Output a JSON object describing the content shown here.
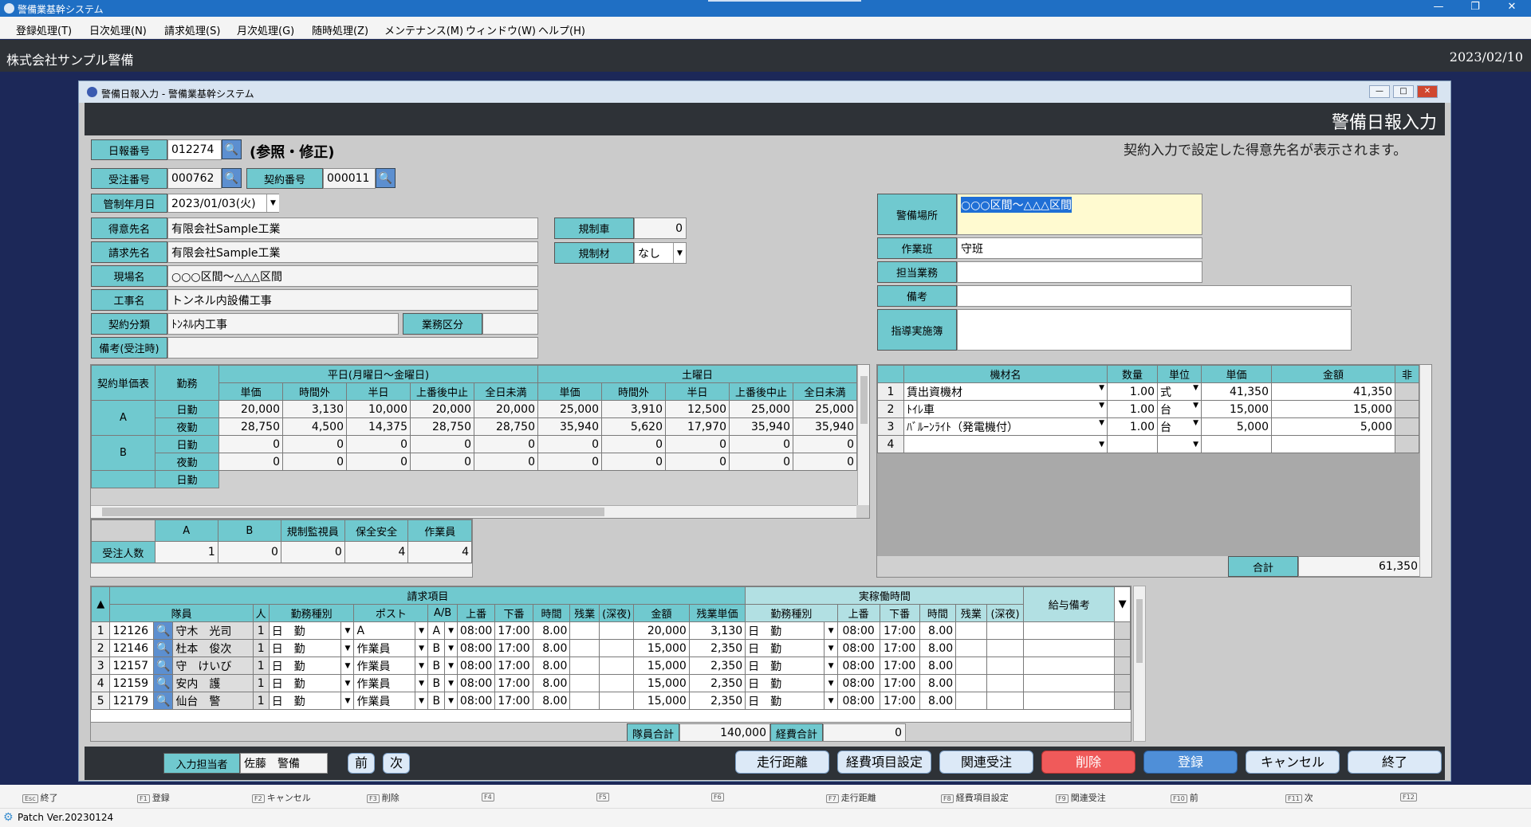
{
  "app": {
    "title": "警備業基幹システム",
    "company": "株式会社サンプル警備",
    "date": "2023/02/10",
    "window_title": "警備日報入力 - 警備業基幹システム",
    "form_title": "警備日報入力",
    "ver": "Patch Ver.20230124"
  },
  "menu": [
    "登録処理(T)",
    "日次処理(N)",
    "請求処理(S)",
    "月次処理(G)",
    "随時処理(Z)",
    "メンテナンス(M)",
    "ウィンドウ(W)",
    "ヘルプ(H)"
  ],
  "form": {
    "nippo_label": "日報番号",
    "nippo": "012274",
    "mode": "(参照・修正)",
    "notice": "契約入力で設定した得意先名が表示されます。",
    "juchu_label": "受注番号",
    "juchu": "000762",
    "keiyaku_label": "契約番号",
    "keiyaku": "000011",
    "kanri_label": "管制年月日",
    "kanri": "2023/01/03(火)",
    "tokui_label": "得意先名",
    "tokui": "有限会社Sample工業",
    "seikyu_label": "請求先名",
    "seikyu": "有限会社Sample工業",
    "genba_label": "現場名",
    "genba": "○○○区間～△△△区間",
    "koji_label": "工事名",
    "koji": "トンネル内設備工事",
    "bunrui_label": "契約分類",
    "bunrui": "ﾄﾝﾈﾙ内工事",
    "gyomu_label": "業務区分",
    "biko_label": "備考(受注時)",
    "kiseisha_label": "規制車",
    "kiseisha": "0",
    "kiseizai_label": "規制材",
    "kiseizai": "なし",
    "basho_label": "警備場所",
    "basho": "○○○区間～△△△区間",
    "han_label": "作業班",
    "han": "守班",
    "tanto_label": "担当業務",
    "biko2_label": "備考",
    "shido_label": "指導実施簿"
  },
  "price": {
    "h_table": "契約単価表",
    "h_kinmu": "勤務",
    "h_weekday": "平日(月曜日～金曜日)",
    "h_sat": "土曜日",
    "cols": [
      "単価",
      "時間外",
      "半日",
      "上番後中止",
      "全日未満"
    ],
    "rows": [
      {
        "g": "A",
        "k": "日勤",
        "v": [
          "20,000",
          "3,130",
          "10,000",
          "20,000",
          "20,000",
          "25,000",
          "3,910",
          "12,500",
          "25,000",
          "25,000"
        ]
      },
      {
        "g": "",
        "k": "夜勤",
        "v": [
          "28,750",
          "4,500",
          "14,375",
          "28,750",
          "28,750",
          "35,940",
          "5,620",
          "17,970",
          "35,940",
          "35,940"
        ]
      },
      {
        "g": "B",
        "k": "日勤",
        "v": [
          "0",
          "0",
          "0",
          "0",
          "0",
          "0",
          "0",
          "0",
          "0",
          "0"
        ]
      },
      {
        "g": "",
        "k": "夜勤",
        "v": [
          "0",
          "0",
          "0",
          "0",
          "0",
          "0",
          "0",
          "0",
          "0",
          "0"
        ]
      }
    ],
    "cut": "日勤"
  },
  "count": {
    "cols": [
      "A",
      "B",
      "規制監視員",
      "保全安全",
      "作業員"
    ],
    "label": "受注人数",
    "vals": [
      "1",
      "0",
      "0",
      "4",
      "4"
    ]
  },
  "equip": {
    "cols": [
      "機材名",
      "数量",
      "単位",
      "単価",
      "金額",
      "非"
    ],
    "rows": [
      {
        "n": "1",
        "name": "賃出資機材",
        "qty": "1.00",
        "unit": "式",
        "price": "41,350",
        "amt": "41,350"
      },
      {
        "n": "2",
        "name": "ﾄｲﾚ車",
        "qty": "1.00",
        "unit": "台",
        "price": "15,000",
        "amt": "15,000"
      },
      {
        "n": "3",
        "name": "ﾊﾞﾙｰﾝﾗｲﾄ（発電機付）",
        "qty": "1.00",
        "unit": "台",
        "price": "5,000",
        "amt": "5,000"
      },
      {
        "n": "4",
        "name": "",
        "qty": "",
        "unit": "",
        "price": "",
        "amt": ""
      }
    ],
    "total_label": "合計",
    "total": "61,350"
  },
  "staff": {
    "h_seikyu": "請求項目",
    "h_jitsu": "実稼働時間",
    "h_kyuyo": "給与備考",
    "cols": [
      "隊員",
      "人",
      "勤務種別",
      "ポスト",
      "A/B",
      "上番",
      "下番",
      "時間",
      "残業",
      "(深夜)",
      "金額",
      "残業単価"
    ],
    "cols2": [
      "勤務種別",
      "上番",
      "下番",
      "時間",
      "残業",
      "(深夜)"
    ],
    "rows": [
      {
        "n": "1",
        "id": "12126",
        "name": "守木　光司",
        "p": "1",
        "kind": "日　勤",
        "post": "A",
        "ab": "A",
        "s": "08:00",
        "e": "17:00",
        "t": "8.00",
        "amt": "20,000",
        "ot": "3,130"
      },
      {
        "n": "2",
        "id": "12146",
        "name": "杜本　俊次",
        "p": "1",
        "kind": "日　勤",
        "post": "作業員",
        "ab": "B",
        "s": "08:00",
        "e": "17:00",
        "t": "8.00",
        "amt": "15,000",
        "ot": "2,350"
      },
      {
        "n": "3",
        "id": "12157",
        "name": "守　けいび",
        "p": "1",
        "kind": "日　勤",
        "post": "作業員",
        "ab": "B",
        "s": "08:00",
        "e": "17:00",
        "t": "8.00",
        "amt": "15,000",
        "ot": "2,350"
      },
      {
        "n": "4",
        "id": "12159",
        "name": "安内　護",
        "p": "1",
        "kind": "日　勤",
        "post": "作業員",
        "ab": "B",
        "s": "08:00",
        "e": "17:00",
        "t": "8.00",
        "amt": "15,000",
        "ot": "2,350"
      },
      {
        "n": "5",
        "id": "12179",
        "name": "仙台　警",
        "p": "1",
        "kind": "日　勤",
        "post": "作業員",
        "ab": "B",
        "s": "08:00",
        "e": "17:00",
        "t": "8.00",
        "amt": "15,000",
        "ot": "2,350"
      }
    ],
    "sum_label": "隊員合計",
    "sum": "140,000",
    "exp_label": "経費合計",
    "exp": "0"
  },
  "bottom": {
    "user_label": "入力担当者",
    "user": "佐藤　警備",
    "prev": "前",
    "next": "次",
    "b1": "走行距離",
    "b2": "経費項目設定",
    "b3": "関連受注",
    "b4": "削除",
    "b5": "登録",
    "b6": "キャンセル",
    "b7": "終了"
  },
  "fkeys": [
    {
      "k": "Esc",
      "l": "終了"
    },
    {
      "k": "F1",
      "l": "登録"
    },
    {
      "k": "F2",
      "l": "キャンセル"
    },
    {
      "k": "F3",
      "l": "削除"
    },
    {
      "k": "F4",
      "l": ""
    },
    {
      "k": "F5",
      "l": ""
    },
    {
      "k": "F6",
      "l": ""
    },
    {
      "k": "F7",
      "l": "走行距離"
    },
    {
      "k": "F8",
      "l": "経費項目設定"
    },
    {
      "k": "F9",
      "l": "関連受注"
    },
    {
      "k": "F10",
      "l": "前"
    },
    {
      "k": "F11",
      "l": "次"
    },
    {
      "k": "F12",
      "l": ""
    }
  ],
  "colors": {
    "accent": "#70c9cf",
    "delete": "#f05a5a",
    "register": "#4f8fd8"
  }
}
